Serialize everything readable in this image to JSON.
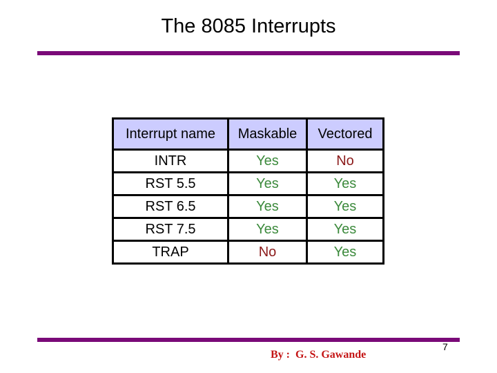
{
  "slide": {
    "title": "The 8085 Interrupts",
    "author": "By :  G. S. Gawande",
    "page_number": "7",
    "accent_color": "#7a0a78"
  },
  "table": {
    "headers": [
      "Interrupt name",
      "Maskable",
      "Vectored"
    ],
    "rows": [
      {
        "name": "INTR",
        "maskable": "Yes",
        "vectored": "No"
      },
      {
        "name": "RST 5.5",
        "maskable": "Yes",
        "vectored": "Yes"
      },
      {
        "name": "RST 6.5",
        "maskable": "Yes",
        "vectored": "Yes"
      },
      {
        "name": "RST 7.5",
        "maskable": "Yes",
        "vectored": "Yes"
      },
      {
        "name": "TRAP",
        "maskable": "No",
        "vectored": "Yes"
      }
    ],
    "colors": {
      "yes": "#3c8a3c",
      "no": "#8b1a1a",
      "header_bg": "#ccccff"
    }
  }
}
